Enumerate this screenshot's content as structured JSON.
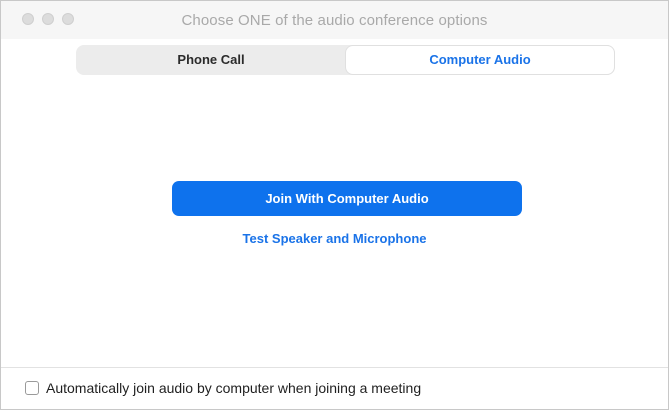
{
  "window": {
    "title": "Choose ONE of the audio conference options"
  },
  "tabs": [
    {
      "label": "Phone Call",
      "selected": false
    },
    {
      "label": "Computer Audio",
      "selected": true
    }
  ],
  "main": {
    "join_button_label": "Join With Computer Audio",
    "test_link_label": "Test Speaker and Microphone"
  },
  "footer": {
    "auto_join_label": "Automatically join audio by computer when joining a meeting",
    "auto_join_checked": false
  },
  "colors": {
    "accent": "#0e72ed",
    "link": "#1a73e8"
  }
}
